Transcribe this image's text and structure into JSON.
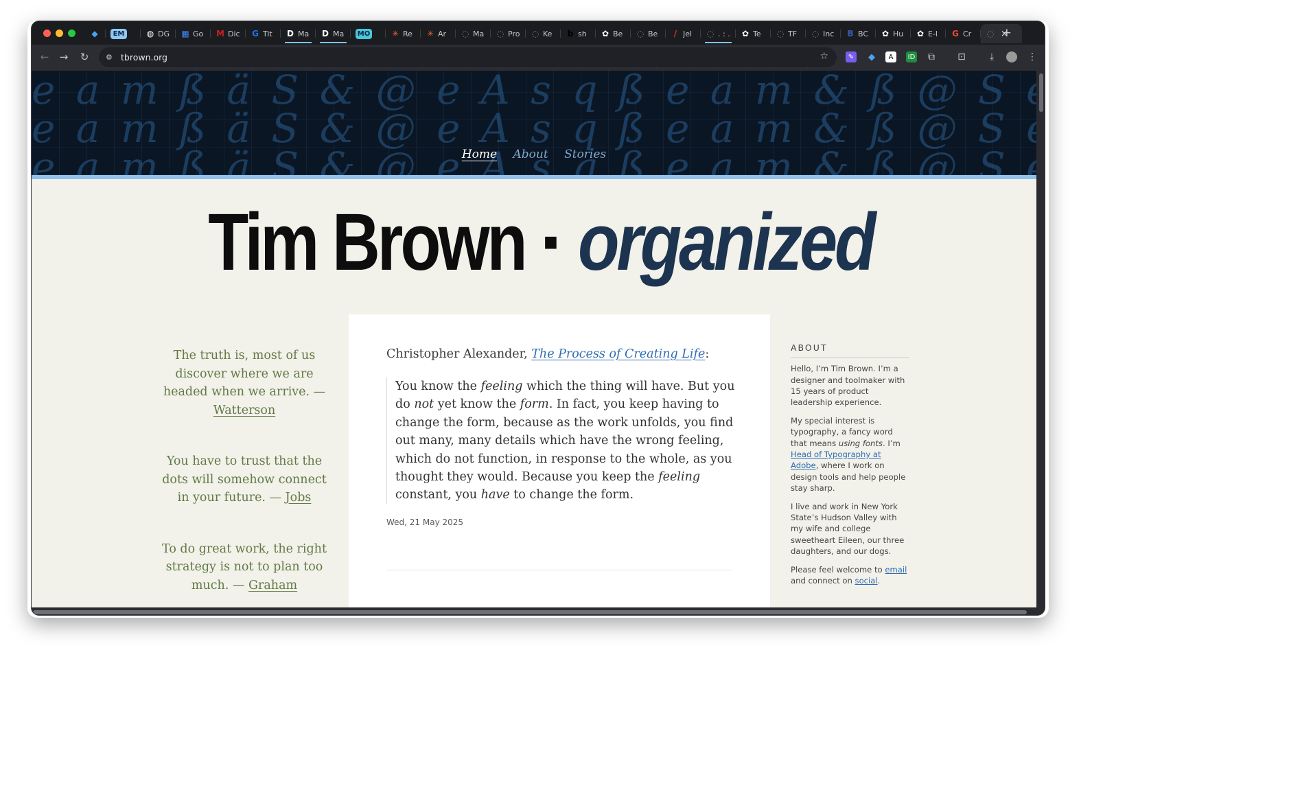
{
  "browser": {
    "tabs": [
      {
        "label": "",
        "icon": "diamond-icon",
        "color": "#4aa3f0"
      },
      {
        "label": "EM",
        "icon": "pill-badge",
        "color": "#8ec8f5",
        "pill": true
      },
      {
        "label": "DG",
        "icon": "globe-icon",
        "color": "#ffffff"
      },
      {
        "label": "Go",
        "icon": "calendar-icon",
        "color": "#4285f4"
      },
      {
        "label": "Dic",
        "icon": "gmail-icon",
        "color": "#c5221f"
      },
      {
        "label": "Tit",
        "icon": "google-g-icon",
        "color": "#1a73e8"
      },
      {
        "label": "Ma",
        "icon": "d-logo-icon",
        "color": "#ffffff"
      },
      {
        "label": "Ma",
        "icon": "d-logo-icon",
        "color": "#ffffff"
      },
      {
        "label": "MO",
        "icon": "pill-badge",
        "color": "#49c6d8",
        "pill": true
      },
      {
        "label": "Re",
        "icon": "asterisk-icon",
        "color": "#e2653c"
      },
      {
        "label": "Ar",
        "icon": "asterisk-icon",
        "color": "#e2653c"
      },
      {
        "label": "Ma",
        "icon": "generic-site-icon",
        "color": "#888888"
      },
      {
        "label": "Pro",
        "icon": "generic-site-icon",
        "color": "#888888"
      },
      {
        "label": "Ke",
        "icon": "generic-site-icon",
        "color": "#888888"
      },
      {
        "label": "sh",
        "icon": "b-logo-icon",
        "color": "#000000"
      },
      {
        "label": "Be",
        "icon": "openai-icon",
        "color": "#ffffff"
      },
      {
        "label": "Be",
        "icon": "generic-site-icon",
        "color": "#888888"
      },
      {
        "label": "Jel",
        "icon": "pen-icon",
        "color": "#d13b3b"
      },
      {
        "label": ". : .",
        "icon": "generic-site-icon",
        "color": "#888888"
      },
      {
        "label": "Te",
        "icon": "openai-icon",
        "color": "#ffffff"
      },
      {
        "label": "TF",
        "icon": "generic-site-icon",
        "color": "#888888"
      },
      {
        "label": "Inc",
        "icon": "generic-site-icon",
        "color": "#888888"
      },
      {
        "label": "BC",
        "icon": "bc-logo-icon",
        "color": "#3b5ba9"
      },
      {
        "label": "Hu",
        "icon": "openai-icon",
        "color": "#ffffff"
      },
      {
        "label": "E-l",
        "icon": "openai-icon",
        "color": "#ffffff"
      },
      {
        "label": "Cr",
        "icon": "google-g-icon",
        "color": "#ea4335"
      }
    ],
    "active_tab_close": "×",
    "new_tab": "+",
    "url": "tbrown.org"
  },
  "site": {
    "nav": [
      "Home",
      "About",
      "Stories"
    ],
    "title_name": "Tim Brown",
    "title_dot": "·",
    "title_org": "organized",
    "hero_glyphs": "e a m ß ä S & @ e A s q ß e a m & ß @ S"
  },
  "quotes": [
    {
      "text": "The truth is, most of us discover where we are headed when we arrive. —",
      "author": "Watterson"
    },
    {
      "text": "You have to trust that the dots will somehow connect in your future. —",
      "author": "Jobs"
    },
    {
      "text": "To do great work, the right strategy is not to plan too much. —",
      "author": "Graham"
    }
  ],
  "post": {
    "attribution": "Christopher Alexander,",
    "book": "The Process of Creating Life",
    "colon": ":",
    "date": "Wed, 21 May 2025"
  },
  "about": {
    "heading": "ABOUT",
    "p1": "Hello, I’m Tim Brown. I’m a designer and toolmaker with 15 years of product leadership experience.",
    "p2_a": "My special interest is typography, a fancy word that means",
    "p2_em": "using fonts",
    "p2_b": ". I’m",
    "p2_link": "Head of Typography at Adobe",
    "p2_c": ", where I work on design tools and help people stay sharp.",
    "p3": "I live and work in New York State’s Hudson Valley with my wife and college sweetheart Eileen, our three daughters, and our dogs.",
    "p4_a": "Please feel welcome to",
    "p4_email": "email",
    "p4_b": "and connect on",
    "p4_social": "social",
    "p4_c": "."
  }
}
